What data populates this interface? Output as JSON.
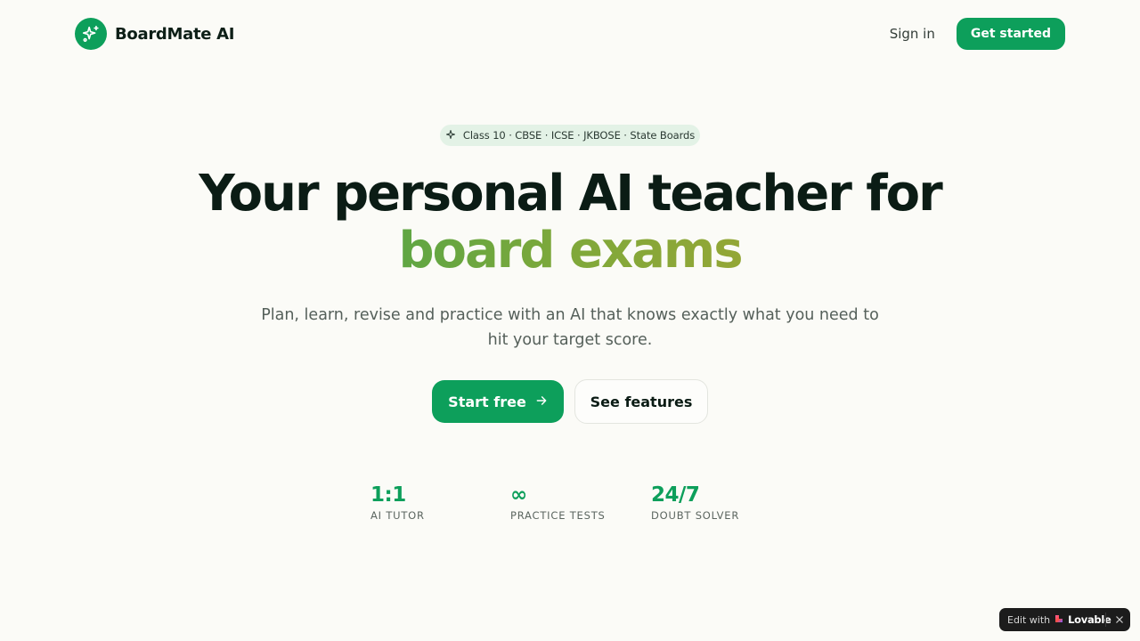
{
  "brand": {
    "name": "BoardMate AI",
    "logo_icon": "sparkles-icon",
    "accent_color": "#0d9f5b"
  },
  "nav": {
    "signin_label": "Sign in",
    "get_started_label": "Get started"
  },
  "hero": {
    "pill_icon": "sparkle-icon",
    "pill_text": "Class 10 · CBSE · ICSE · JKBOSE · State Boards",
    "headline_line1": "Your personal AI teacher for",
    "headline_line2": "board exams",
    "headline_gradient": [
      "#14a05a",
      "#c2a32e"
    ],
    "subtext": "Plan, learn, revise and practice with an AI that knows exactly what you need to hit your target score.",
    "primary_cta": "Start free",
    "primary_cta_icon": "arrow-right-icon",
    "secondary_cta": "See features"
  },
  "stats": [
    {
      "value": "1:1",
      "label": "AI TUTOR"
    },
    {
      "value": "∞",
      "label": "PRACTICE TESTS"
    },
    {
      "value": "24/7",
      "label": "DOUBT SOLVER"
    }
  ],
  "badge": {
    "prefix": "Edit with",
    "brand": "Lovable",
    "brand_icon": "lovable-heart-icon",
    "close_icon": "close-icon"
  }
}
